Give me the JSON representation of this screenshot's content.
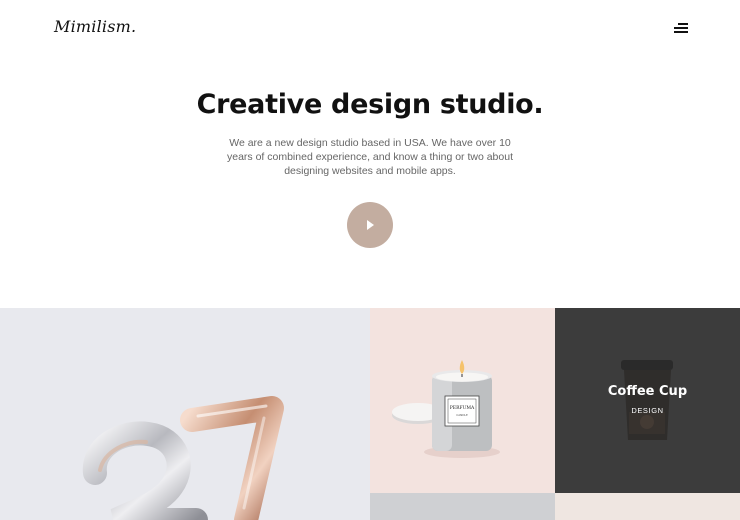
{
  "header": {
    "logo": "Mimilism."
  },
  "hero": {
    "title": "Creative design studio.",
    "description": "We are a new design studio based in USA. We have over 10 years of combined experience, and know a thing or two about designing websites and mobile apps."
  },
  "portfolio": {
    "coffee_title": "Coffee Cup",
    "coffee_category": "DESIGN",
    "candle_label_line1": "PERFUMA",
    "candle_label_line2": "CANDLE"
  },
  "colors": {
    "accent": "#c3ada0",
    "candle_bg": "#f3e3df",
    "coffee_bg": "#3c3c3c",
    "balloon_bg": "#e8e9ee"
  },
  "icons": {
    "menu": "hamburger-icon",
    "play": "play-icon"
  }
}
